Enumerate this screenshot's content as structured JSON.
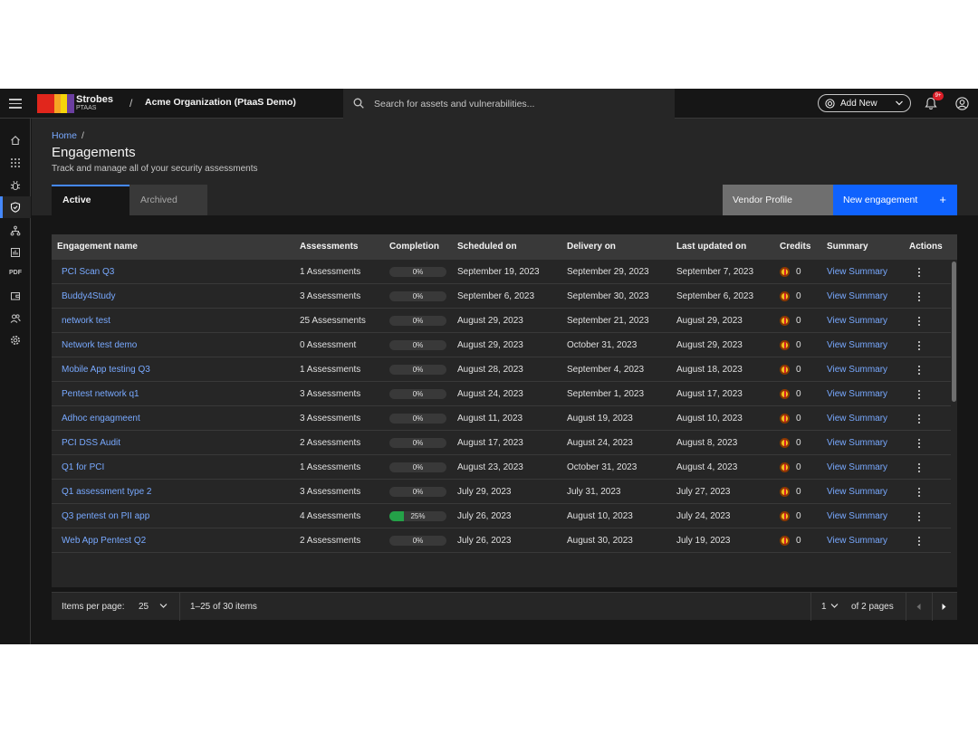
{
  "header": {
    "brand_name": "Strobes",
    "brand_sub": "PTAAS",
    "separator": "/",
    "org_name": "Acme Organization (PtaaS Demo)",
    "search_placeholder": "Search for assets and vulnerabilities...",
    "add_new_label": "Add New",
    "notification_badge": "9+",
    "logo_colors": [
      "#e1261c",
      "#f5a623",
      "#f5d40a",
      "#6b3fa0"
    ]
  },
  "sidenav": {
    "items": [
      "home-icon",
      "apps-grid-icon",
      "bug-icon",
      "shield-check-icon",
      "network-icon",
      "report-icon",
      "pdf-icon",
      "wallet-icon",
      "users-icon",
      "settings-icon"
    ],
    "pdf_label": "PDF",
    "active_index": 3
  },
  "page": {
    "breadcrumb_home": "Home",
    "breadcrumb_sep": "/",
    "title": "Engagements",
    "subtitle": "Track and manage all of your security assessments",
    "tabs": [
      {
        "label": "Active",
        "selected": true
      },
      {
        "label": "Archived",
        "selected": false
      }
    ],
    "vendor_profile_label": "Vendor Profile",
    "new_engagement_label": "New engagement",
    "new_engagement_icon": "+"
  },
  "table": {
    "columns": [
      "Engagement name",
      "Assessments",
      "Completion",
      "Scheduled on",
      "Delivery on",
      "Last updated on",
      "Credits",
      "Summary",
      "Actions"
    ],
    "rows": [
      {
        "name": "PCI Scan Q3",
        "assessments": "1 Assessments",
        "completion": "0%",
        "completion_value": 0,
        "scheduled": "September 19, 2023",
        "delivery": "September 29, 2023",
        "updated": "September 7, 2023",
        "credits": "0",
        "summary": "View Summary"
      },
      {
        "name": "Buddy4Study",
        "assessments": "3 Assessments",
        "completion": "0%",
        "completion_value": 0,
        "scheduled": "September 6, 2023",
        "delivery": "September 30, 2023",
        "updated": "September 6, 2023",
        "credits": "0",
        "summary": "View Summary"
      },
      {
        "name": "network test",
        "assessments": "25 Assessments",
        "completion": "0%",
        "completion_value": 0,
        "scheduled": "August 29, 2023",
        "delivery": "September 21, 2023",
        "updated": "August 29, 2023",
        "credits": "0",
        "summary": "View Summary"
      },
      {
        "name": "Network test demo",
        "assessments": "0 Assessment",
        "completion": "0%",
        "completion_value": 0,
        "scheduled": "August 29, 2023",
        "delivery": "October 31, 2023",
        "updated": "August 29, 2023",
        "credits": "0",
        "summary": "View Summary"
      },
      {
        "name": "Mobile App testing Q3",
        "assessments": "1 Assessments",
        "completion": "0%",
        "completion_value": 0,
        "scheduled": "August 28, 2023",
        "delivery": "September 4, 2023",
        "updated": "August 18, 2023",
        "credits": "0",
        "summary": "View Summary"
      },
      {
        "name": "Pentest network q1",
        "assessments": "3 Assessments",
        "completion": "0%",
        "completion_value": 0,
        "scheduled": "August 24, 2023",
        "delivery": "September 1, 2023",
        "updated": "August 17, 2023",
        "credits": "0",
        "summary": "View Summary"
      },
      {
        "name": "Adhoc engagmeent",
        "assessments": "3 Assessments",
        "completion": "0%",
        "completion_value": 0,
        "scheduled": "August 11, 2023",
        "delivery": "August 19, 2023",
        "updated": "August 10, 2023",
        "credits": "0",
        "summary": "View Summary"
      },
      {
        "name": "PCI DSS Audit",
        "assessments": "2 Assessments",
        "completion": "0%",
        "completion_value": 0,
        "scheduled": "August 17, 2023",
        "delivery": "August 24, 2023",
        "updated": "August 8, 2023",
        "credits": "0",
        "summary": "View Summary"
      },
      {
        "name": "Q1 for PCI",
        "assessments": "1 Assessments",
        "completion": "0%",
        "completion_value": 0,
        "scheduled": "August 23, 2023",
        "delivery": "October 31, 2023",
        "updated": "August 4, 2023",
        "credits": "0",
        "summary": "View Summary"
      },
      {
        "name": "Q1 assessment type 2",
        "assessments": "3 Assessments",
        "completion": "0%",
        "completion_value": 0,
        "scheduled": "July 29, 2023",
        "delivery": "July 31, 2023",
        "updated": "July 27, 2023",
        "credits": "0",
        "summary": "View Summary"
      },
      {
        "name": "Q3 pentest on PII app",
        "assessments": "4 Assessments",
        "completion": "25%",
        "completion_value": 25,
        "scheduled": "July 26, 2023",
        "delivery": "August 10, 2023",
        "updated": "July 24, 2023",
        "credits": "0",
        "summary": "View Summary"
      },
      {
        "name": "Web App Pentest Q2",
        "assessments": "2 Assessments",
        "completion": "0%",
        "completion_value": 0,
        "scheduled": "July 26, 2023",
        "delivery": "August 30, 2023",
        "updated": "July 19, 2023",
        "credits": "0",
        "summary": "View Summary"
      }
    ]
  },
  "pagination": {
    "items_per_page_label": "Items per page:",
    "items_per_page_value": "25",
    "range_text": "1–25 of 30 items",
    "page_value": "1",
    "pages_text": "of 2 pages"
  }
}
